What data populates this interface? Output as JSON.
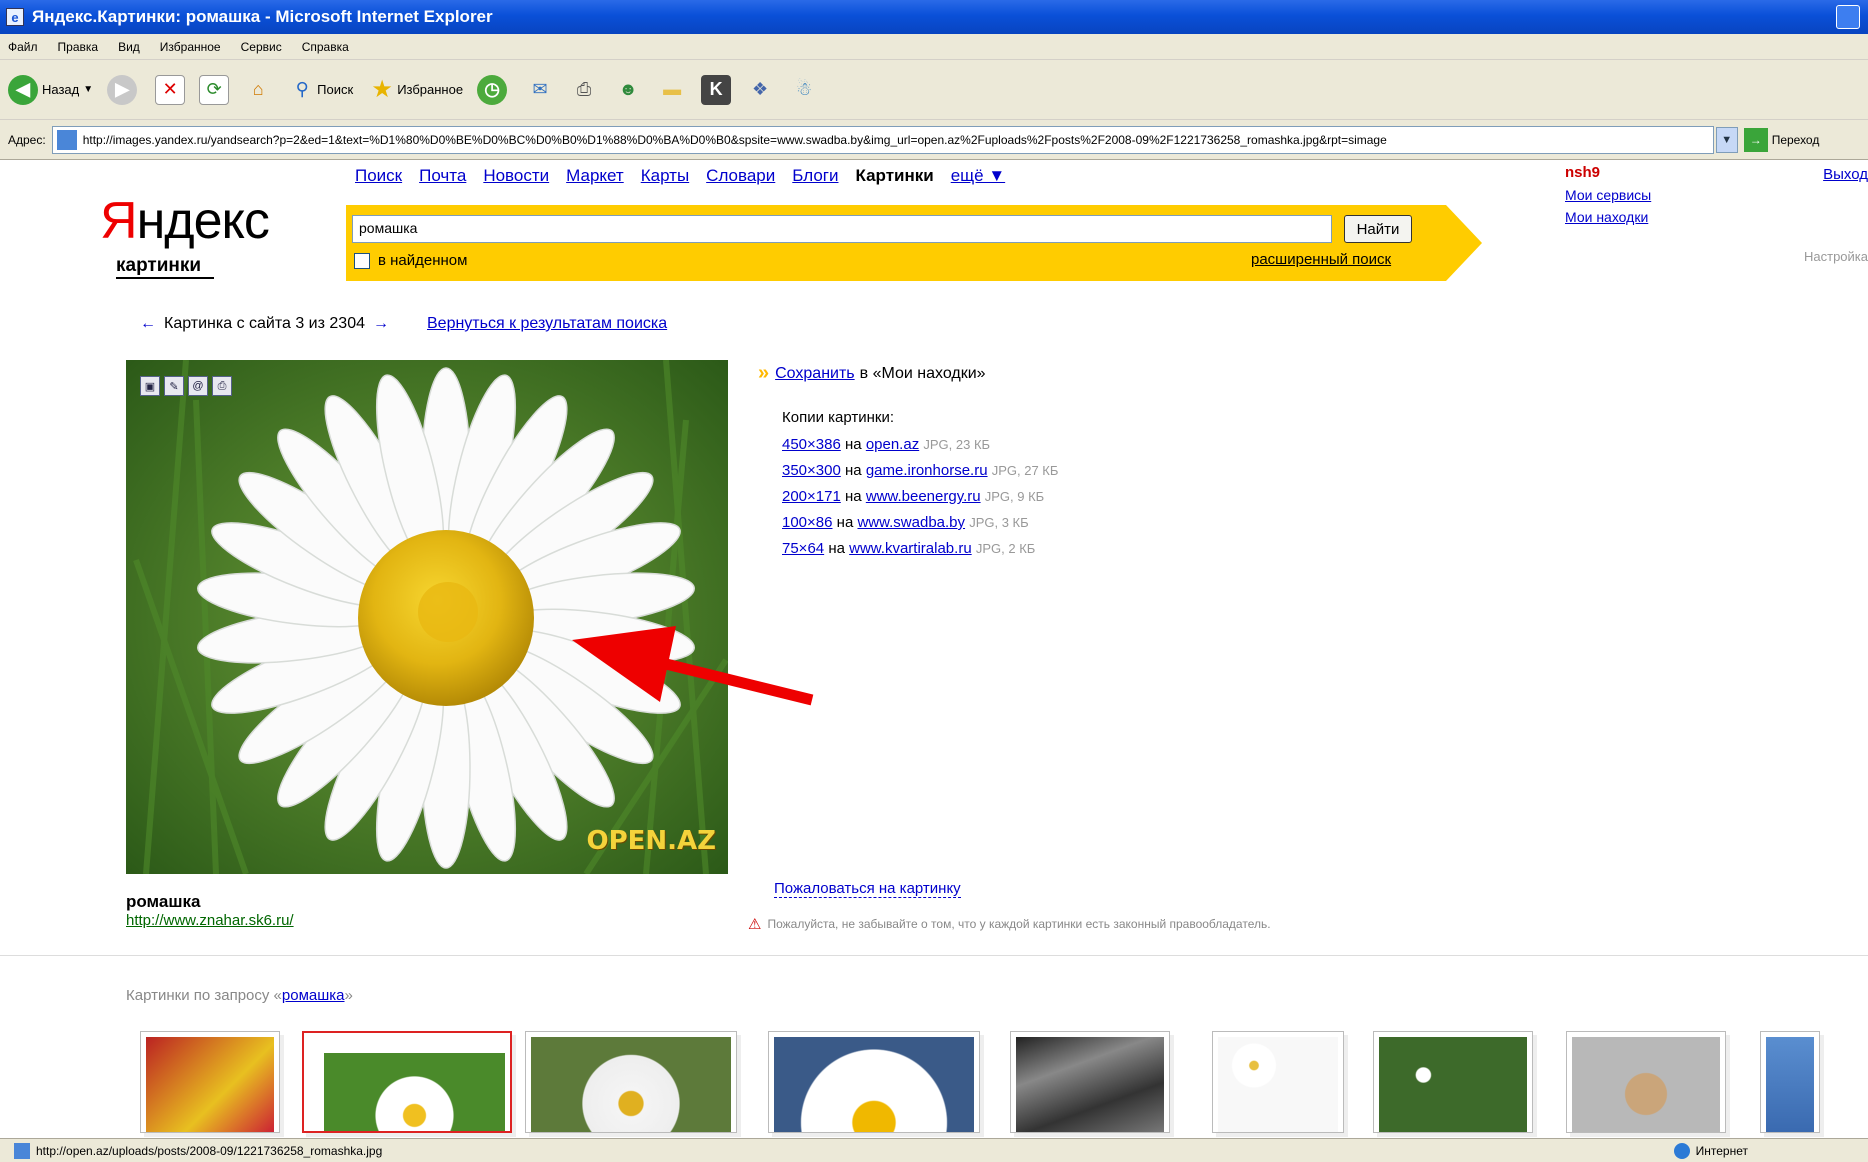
{
  "window": {
    "title": "Яндекс.Картинки: ромашка - Microsoft Internet Explorer"
  },
  "menu": [
    "Файл",
    "Правка",
    "Вид",
    "Избранное",
    "Сервис",
    "Справка"
  ],
  "toolbar": {
    "back": "Назад",
    "search": "Поиск",
    "favorites": "Избранное"
  },
  "address": {
    "label": "Адрес:",
    "url": "http://images.yandex.ru/yandsearch?p=2&ed=1&text=%D1%80%D0%BE%D0%BC%D0%B0%D1%88%D0%BA%D0%B0&spsite=www.swadba.by&img_url=open.az%2Fuploads%2Fposts%2F2008-09%2F1221736258_romashka.jpg&rpt=simage",
    "go": "Переход"
  },
  "nav": {
    "items": [
      "Поиск",
      "Почта",
      "Новости",
      "Маркет",
      "Карты",
      "Словари",
      "Блоги"
    ],
    "active": "Картинки",
    "more": "ещё ▼"
  },
  "user": {
    "name": "nsh9",
    "services": "Мои сервисы",
    "finds": "Мои находки",
    "logout": "Выход",
    "settings": "Настройка"
  },
  "logo": {
    "y": "Я",
    "rest": "ндекс",
    "sub": "картинки"
  },
  "search": {
    "query": "ромашка",
    "button": "Найти",
    "in_found": "в найденном",
    "advanced": "расширенный поиск"
  },
  "pager": {
    "text": "Картинка с сайта 3 из 2304",
    "back_link": "Вернуться к результатам поиска"
  },
  "image": {
    "watermark": "OPEN.AZ",
    "caption": "ромашка",
    "source": "http://www.znahar.sk6.ru/"
  },
  "save": {
    "link": "Сохранить",
    "rest": "в «Мои находки»"
  },
  "copies": {
    "heading": "Копии картинки:",
    "items": [
      {
        "size": "450×386",
        "on": "на",
        "site": "open.az",
        "meta": "JPG, 23 КБ"
      },
      {
        "size": "350×300",
        "on": "на",
        "site": "game.ironhorse.ru",
        "meta": "JPG, 27 КБ"
      },
      {
        "size": "200×171",
        "on": "на",
        "site": "www.beenergy.ru",
        "meta": "JPG, 9 КБ"
      },
      {
        "size": "100×86",
        "on": "на",
        "site": "www.swadba.by",
        "meta": "JPG, 3 КБ"
      },
      {
        "size": "75×64",
        "on": "на",
        "site": "www.kvartiralab.ru",
        "meta": "JPG, 2 КБ"
      }
    ]
  },
  "complain": "Пожаловаться на картинку",
  "warning": "Пожалуйста, не забывайте о том, что у каждой картинки есть законный правообладатель.",
  "related": {
    "prefix": "Картинки по запросу «",
    "query": "ромашка",
    "suffix": "»"
  },
  "status": {
    "url": "http://open.az/uploads/posts/2008-09/1221736258_romashka.jpg",
    "zone": "Интернет"
  },
  "colors": {
    "yandex_yellow": "#ffcc00",
    "link": "#0000cc",
    "arrow": "#ee0000"
  }
}
